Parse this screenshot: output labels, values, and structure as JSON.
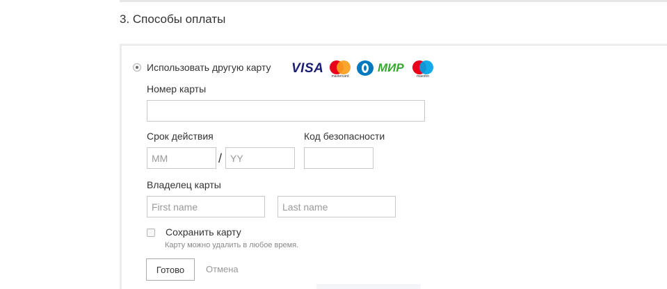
{
  "section": {
    "title": "3. Способы оплаты"
  },
  "payment_option": {
    "label": "Использовать другую карту",
    "selected": true
  },
  "card_logos": {
    "visa": "VISA",
    "mastercard_caption": "mastercard",
    "mir": "МИР",
    "maestro_caption": "maestro"
  },
  "fields": {
    "card_number_label": "Номер карты",
    "card_number_value": "",
    "expiry_label": "Срок действия",
    "month_placeholder": "MM",
    "year_placeholder": "YY",
    "separator": "/",
    "security_label": "Код безопасности",
    "owner_label": "Владелец карты",
    "first_name_placeholder": "First name",
    "last_name_placeholder": "Last name"
  },
  "save_card": {
    "label": "Сохранить карту",
    "hint": "Карту можно удалить в любое время.",
    "checked": false
  },
  "actions": {
    "done": "Готово",
    "cancel": "Отмена"
  },
  "colors": {
    "visa": "#1a1f71",
    "mastercard_red": "#eb001b",
    "mastercard_yellow": "#f79e1b",
    "mir": "#37a72e",
    "maestro_blue": "#00a2e5",
    "diners": "#0079be"
  }
}
